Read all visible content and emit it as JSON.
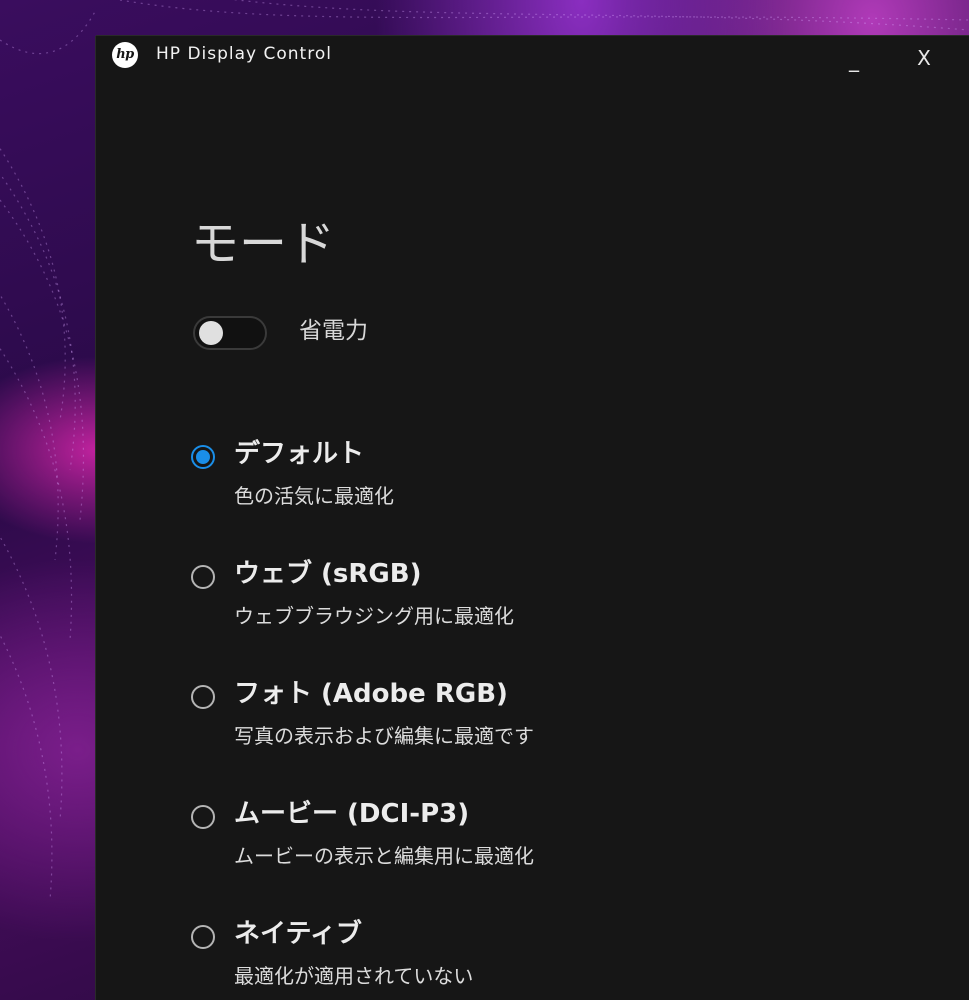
{
  "window": {
    "app_title": "HP Display Control",
    "logo_text": "hp",
    "minimize_label": "_",
    "close_label": "X"
  },
  "page": {
    "title": "モード"
  },
  "power_saving": {
    "label": "省電力",
    "enabled": false
  },
  "modes": [
    {
      "name": "デフォルト",
      "description": "色の活気に最適化",
      "selected": true
    },
    {
      "name": "ウェブ (sRGB)",
      "description": "ウェブブラウジング用に最適化",
      "selected": false
    },
    {
      "name": "フォト (Adobe RGB)",
      "description": "写真の表示および編集に最適です",
      "selected": false
    },
    {
      "name": "ムービー (DCI-P3)",
      "description": "ムービーの表示と編集用に最適化",
      "selected": false
    },
    {
      "name": "ネイティブ",
      "description": "最適化が適用されていない",
      "selected": false
    }
  ],
  "colors": {
    "window_bg": "#161616",
    "accent_radio": "#1a8ee8",
    "text_primary": "#ececec"
  }
}
